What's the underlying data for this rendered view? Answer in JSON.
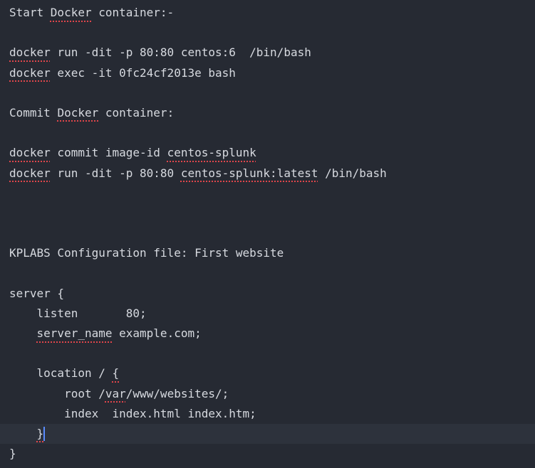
{
  "editor": {
    "background": "#262a33",
    "text_color": "#d7dae0",
    "spellcheck_color": "#e0464b",
    "caret_color": "#5a8cff",
    "lines": [
      [
        {
          "t": "Start "
        },
        {
          "t": "Docker",
          "sp": true
        },
        {
          "t": " container:-"
        }
      ],
      [],
      [
        {
          "t": "docker",
          "sp": true
        },
        {
          "t": " run -dit -p 80:80 centos:6  /bin/bash"
        }
      ],
      [
        {
          "t": "docker",
          "sp": true
        },
        {
          "t": " exec -it 0fc24cf2013e bash"
        }
      ],
      [],
      [
        {
          "t": "Commit "
        },
        {
          "t": "Docker",
          "sp": true
        },
        {
          "t": " container:"
        }
      ],
      [],
      [
        {
          "t": "docker",
          "sp": true
        },
        {
          "t": " commit image-id "
        },
        {
          "t": "centos-splunk",
          "sp": true
        }
      ],
      [
        {
          "t": "docker",
          "sp": true
        },
        {
          "t": " run -dit -p 80:80 "
        },
        {
          "t": "centos-splunk:latest",
          "sp": true
        },
        {
          "t": " /bin/bash"
        }
      ],
      [],
      [],
      [],
      [
        {
          "t": "KPLABS Configuration file: First website"
        }
      ],
      [],
      [
        {
          "t": "server {"
        }
      ],
      [
        {
          "t": "    listen       80;"
        }
      ],
      [
        {
          "t": "    "
        },
        {
          "t": "server_name",
          "sp": true
        },
        {
          "t": " example.com;"
        }
      ],
      [],
      [
        {
          "t": "    location / "
        },
        {
          "t": "{",
          "sp": true
        }
      ],
      [
        {
          "t": "        root /"
        },
        {
          "t": "var",
          "sp": true
        },
        {
          "t": "/www/websites/;"
        }
      ],
      [
        {
          "t": "        index  index.html index.htm;"
        }
      ],
      [
        {
          "t": "    "
        },
        {
          "t": "}",
          "sp": true
        },
        {
          "caret": true
        }
      ],
      [
        {
          "t": "}"
        }
      ]
    ],
    "active_line": 21
  }
}
